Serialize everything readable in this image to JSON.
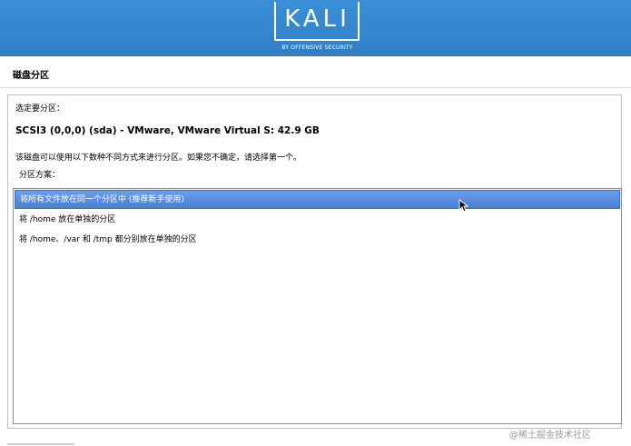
{
  "header": {
    "logo_text": "KALI",
    "logo_subtitle": "BY OFFENSIVE SECURITY"
  },
  "page": {
    "title": "磁盘分区"
  },
  "content": {
    "select_label": "选定要分区：",
    "disk": "SCSI3 (0,0,0) (sda) - VMware, VMware Virtual S: 42.9 GB",
    "description": "该磁盘可以使用以下数种不同方式来进行分区。如果您不确定，请选择第一个。",
    "scheme_label": "分区方案："
  },
  "options": [
    {
      "label": "将所有文件放在同一个分区中 (推荐新手使用)",
      "selected": true
    },
    {
      "label": "将 /home 放在单独的分区",
      "selected": false
    },
    {
      "label": "将 /home、/var 和 /tmp 都分别放在单独的分区",
      "selected": false
    }
  ],
  "watermark": "@稀土掘金技术社区",
  "colors": {
    "banner": "#2f7fc6",
    "selection": "#4a7fd6"
  }
}
